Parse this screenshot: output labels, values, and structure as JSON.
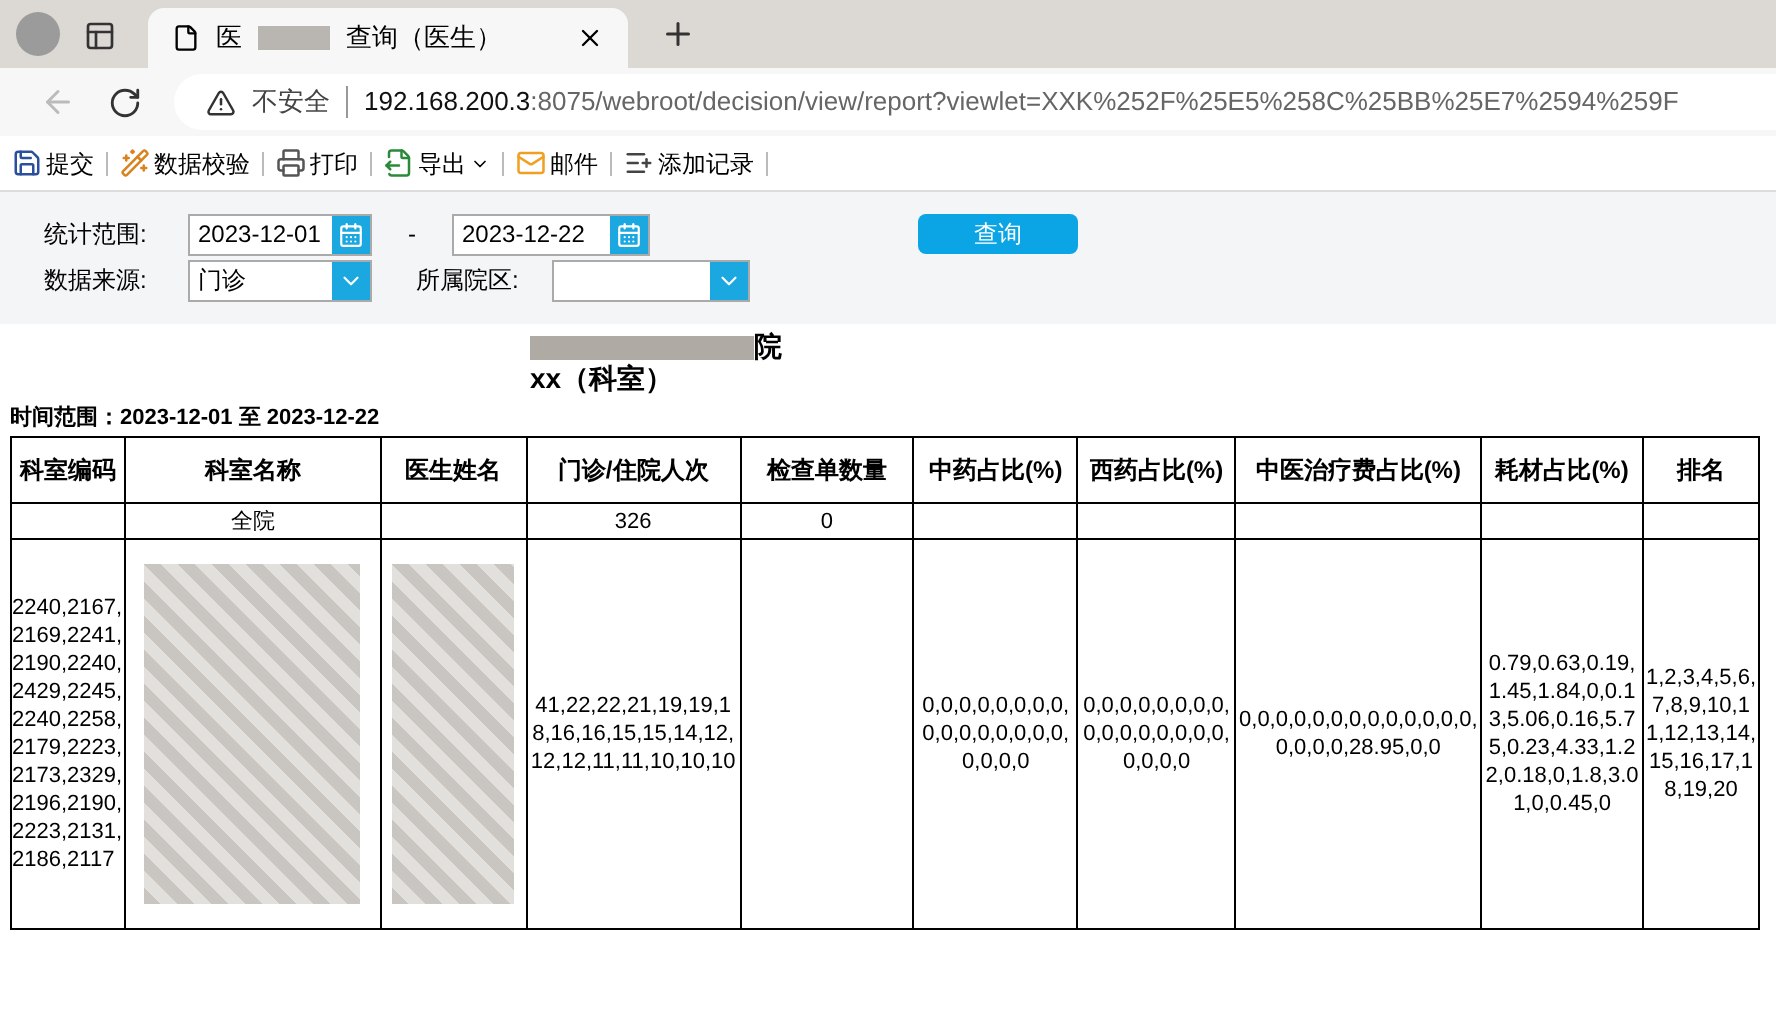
{
  "browser": {
    "tab": {
      "title_start": "医",
      "title_end": "查询（医生）",
      "selected": true
    },
    "security_label": "不安全",
    "url_host": "192.168.200.3",
    "url_rest": ":8075/webroot/decision/view/report?viewlet=XXK%252F%25E5%258C%25BB%25E7%2594%259F"
  },
  "toolbar": [
    {
      "kind": "save",
      "label": "提交"
    },
    {
      "kind": "check",
      "label": "数据校验"
    },
    {
      "kind": "print",
      "label": "打印"
    },
    {
      "kind": "export",
      "label": "导出"
    },
    {
      "kind": "mail",
      "label": "邮件"
    },
    {
      "kind": "add",
      "label": "添加记录"
    }
  ],
  "filters": {
    "range_label": "统计范围:",
    "date_from": "2023-12-01",
    "dash": "-",
    "date_to": "2023-12-22",
    "source_label": "数据来源:",
    "source_value": "门诊",
    "campus_label": "所属院区:",
    "query_button": "查询"
  },
  "report": {
    "title_end": "院",
    "subtitle": "xx（科室）",
    "time_range": "时间范围：2023-12-01 至 2023-12-22",
    "columns": [
      "科室编码",
      "科室名称",
      "医生姓名",
      "门诊/住院人次",
      "检查单数量",
      "中药占比(%)",
      "西药占比(%)",
      "中医治疗费占比(%)",
      "耗材占比(%)",
      "排名"
    ],
    "rows": [
      {
        "kind": "total",
        "cells": [
          "",
          "全院",
          "",
          "326",
          "0",
          "",
          "",
          "",
          "",
          ""
        ]
      },
      {
        "kind": "detail",
        "cells": [
          "2240,2167,2169,2241,2190,2240,2429,2245,2240,2258,2179,2223,2173,2329,2196,2190,2223,2131,2186,2117",
          "",
          "",
          "41,22,22,21,19,19,18,16,16,15,15,14,12,12,12,11,11,10,10,10",
          "",
          "0,0,0,0,0,0,0,0,0,0,0,0,0,0,0,0,0,0,0,0",
          "0,0,0,0,0,0,0,0,0,0,0,0,0,0,0,0,0,0,0,0",
          "0,0,0,0,0,0,0,0,0,0,0,0,0,0,0,0,0,28.95,0,0",
          "0.79,0.63,0.19,1.45,1.84,0,0.13,5.06,0.16,5.75,0.23,4.33,1.22,0.18,0,1.8,3.01,0,0.45,0",
          "1,2,3,4,5,6,7,8,9,10,11,12,13,14,15,16,17,18,19,20"
        ]
      }
    ]
  }
}
